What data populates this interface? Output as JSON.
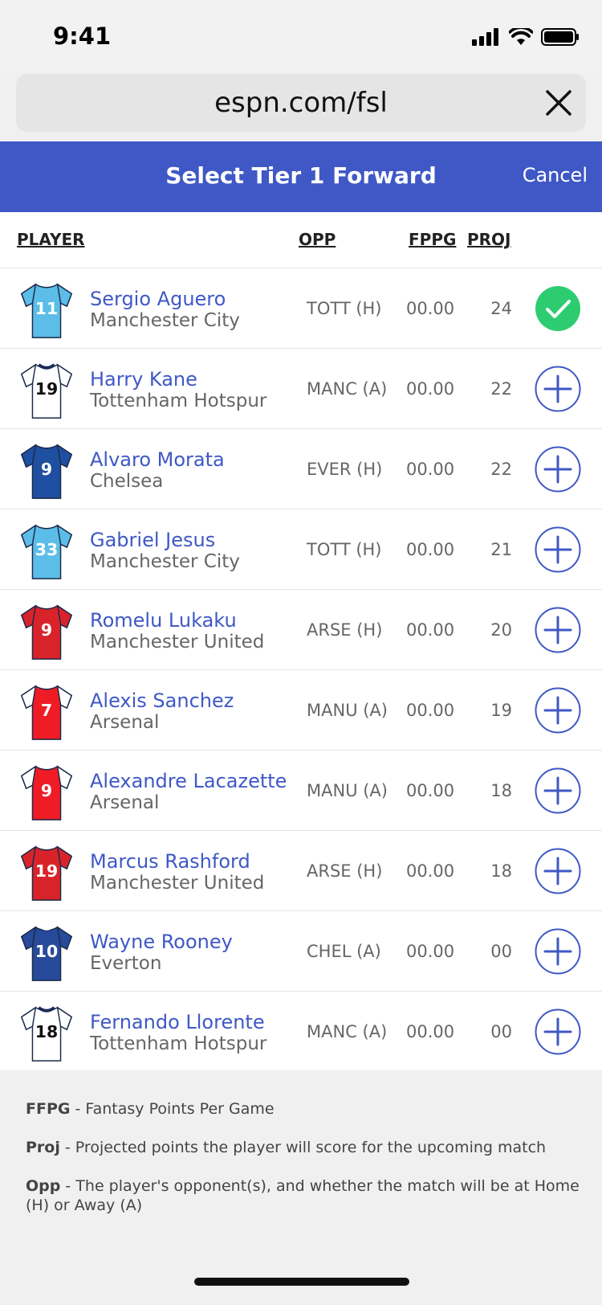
{
  "status_bar": {
    "time": "9:41"
  },
  "browser": {
    "url": "espn.com/fsl"
  },
  "header": {
    "title": "Select Tier 1 Forward",
    "cancel_label": "Cancel",
    "color": "#3f58c6"
  },
  "columns": {
    "player": "PLAYER",
    "opp": "OPP",
    "fppg": "FPPG",
    "proj": "PROJ"
  },
  "players": [
    {
      "name": "Sergio Aguero",
      "team": "Manchester City",
      "opp": "TOTT (H)",
      "fppg": "00.00",
      "proj": "24",
      "number": "11",
      "kit": "#5bbde8",
      "kit_style": "solid",
      "selected": true
    },
    {
      "name": "Harry Kane",
      "team": "Tottenham Hotspur",
      "opp": "MANC (A)",
      "fppg": "00.00",
      "proj": "22",
      "number": "19",
      "kit": "#ffffff",
      "kit_style": "spurs",
      "selected": false
    },
    {
      "name": "Alvaro Morata",
      "team": "Chelsea",
      "opp": "EVER (H)",
      "fppg": "00.00",
      "proj": "22",
      "number": "9",
      "kit": "#1f4fa0",
      "kit_style": "solid",
      "selected": false
    },
    {
      "name": "Gabriel Jesus",
      "team": "Manchester City",
      "opp": "TOTT (H)",
      "fppg": "00.00",
      "proj": "21",
      "number": "33",
      "kit": "#5bbde8",
      "kit_style": "solid",
      "selected": false
    },
    {
      "name": "Romelu Lukaku",
      "team": "Manchester United",
      "opp": "ARSE (H)",
      "fppg": "00.00",
      "proj": "20",
      "number": "9",
      "kit": "#d9232a",
      "kit_style": "solid",
      "selected": false
    },
    {
      "name": "Alexis Sanchez",
      "team": "Arsenal",
      "opp": "MANU (A)",
      "fppg": "00.00",
      "proj": "19",
      "number": "7",
      "kit": "#ef1c25",
      "kit_style": "arsenal",
      "selected": false
    },
    {
      "name": "Alexandre Lacazette",
      "team": "Arsenal",
      "opp": "MANU (A)",
      "fppg": "00.00",
      "proj": "18",
      "number": "9",
      "kit": "#ef1c25",
      "kit_style": "arsenal",
      "selected": false
    },
    {
      "name": "Marcus Rashford",
      "team": "Manchester United",
      "opp": "ARSE (H)",
      "fppg": "00.00",
      "proj": "18",
      "number": "19",
      "kit": "#d9232a",
      "kit_style": "solid",
      "selected": false
    },
    {
      "name": "Wayne Rooney",
      "team": "Everton",
      "opp": "CHEL (A)",
      "fppg": "00.00",
      "proj": "00",
      "number": "10",
      "kit": "#274a9a",
      "kit_style": "everton",
      "selected": false
    },
    {
      "name": "Fernando Llorente",
      "team": "Tottenham Hotspur",
      "opp": "MANC (A)",
      "fppg": "00.00",
      "proj": "00",
      "number": "18",
      "kit": "#ffffff",
      "kit_style": "spurs",
      "selected": false
    }
  ],
  "legend": [
    {
      "term": "FFPG",
      "text": " - Fantasy Points Per Game"
    },
    {
      "term": "Proj",
      "text": " - Projected points the player will score for the upcoming match"
    },
    {
      "term": "Opp",
      "text": " - The player's opponent(s), and whether the match will be at Home (H) or Away (A)"
    }
  ],
  "colors": {
    "accent": "#3f58c6",
    "selected": "#2ecc71"
  }
}
